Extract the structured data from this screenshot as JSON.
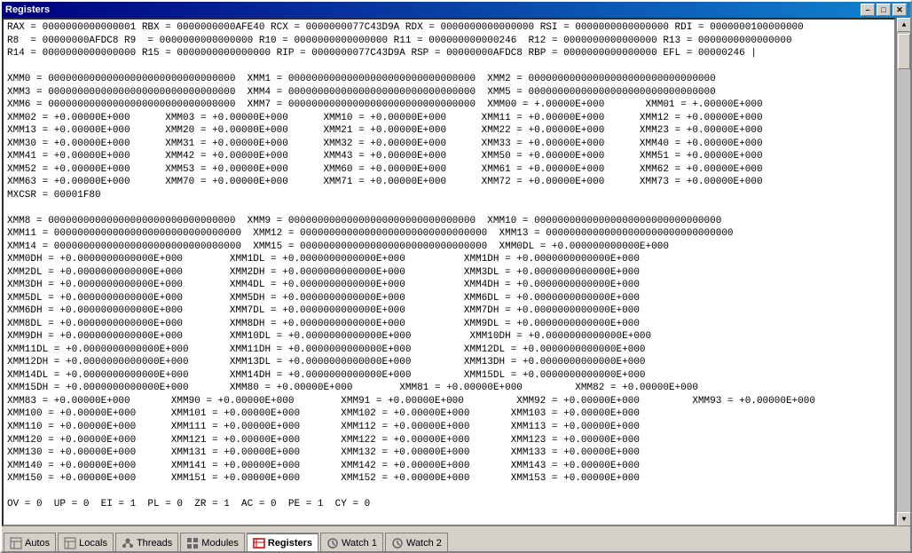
{
  "window": {
    "title": "Registers"
  },
  "title_buttons": {
    "minimize": "0",
    "maximize": "1",
    "close": "×"
  },
  "content": {
    "lines": [
      "RAX = 0000000000000001 RBX = 0000000000AFE40 RCX = 0000000077C43D9A RDX = 0000000000000000 RSI = 0000000000000000 RDI = 0000000100000000",
      "R8  = 00000000AFDC8 R9  = 0000000000000000 R10 = 0000000000000000 R11 = 000000000000246  R12 = 0000000000000000 R13 = 0000000000000000",
      "R14 = 0000000000000000 R15 = 0000000000000000 RIP = 0000000077C43D9A RSP = 00000000AFDC8 RBP = 0000000000000000 EFL = 00000246 |",
      "",
      "XMM0 = 00000000000000000000000000000000  XMM1 = 00000000000000000000000000000000  XMM2 = 00000000000000000000000000000000",
      "XMM3 = 00000000000000000000000000000000  XMM4 = 00000000000000000000000000000000  XMM5 = 00000000000000000000000000000000",
      "XMM6 = 00000000000000000000000000000000  XMM7 = 00000000000000000000000000000000  XMM00 = +.00000E+000       XMM01 = +.00000E+000",
      "XMM02 = +0.00000E+000      XMM03 = +0.00000E+000      XMM10 = +0.00000E+000      XMM11 = +0.00000E+000      XMM12 = +0.00000E+000",
      "XMM13 = +0.00000E+000      XMM20 = +0.00000E+000      XMM21 = +0.00000E+000      XMM22 = +0.00000E+000      XMM23 = +0.00000E+000",
      "XMM30 = +0.00000E+000      XMM31 = +0.00000E+000      XMM32 = +0.00000E+000      XMM33 = +0.00000E+000      XMM40 = +0.00000E+000",
      "XMM41 = +0.00000E+000      XMM42 = +0.00000E+000      XMM43 = +0.00000E+000      XMM50 = +0.00000E+000      XMM51 = +0.00000E+000",
      "XMM52 = +0.00000E+000      XMM53 = +0.00000E+000      XMM60 = +0.00000E+000      XMM61 = +0.00000E+000      XMM62 = +0.00000E+000",
      "XMM63 = +0.00000E+000      XMM70 = +0.00000E+000      XMM71 = +0.00000E+000      XMM72 = +0.00000E+000      XMM73 = +0.00000E+000",
      "MXCSR = 00001F80",
      "",
      "XMM8 = 00000000000000000000000000000000  XMM9 = 00000000000000000000000000000000  XMM10 = 00000000000000000000000000000000",
      "XMM11 = 00000000000000000000000000000000  XMM12 = 00000000000000000000000000000000  XMM13 = 00000000000000000000000000000000",
      "XMM14 = 00000000000000000000000000000000  XMM15 = 00000000000000000000000000000000  XMM0DL = +0.000000000000E+000",
      "XMM0DH = +0.0000000000000E+000        XMM1DL = +0.0000000000000E+000          XMM1DH = +0.0000000000000E+000",
      "XMM2DL = +0.0000000000000E+000        XMM2DH = +0.0000000000000E+000          XMM3DL = +0.0000000000000E+000",
      "XMM3DH = +0.0000000000000E+000        XMM4DL = +0.0000000000000E+000          XMM4DH = +0.0000000000000E+000",
      "XMM5DL = +0.0000000000000E+000        XMM5DH = +0.0000000000000E+000          XMM6DL = +0.0000000000000E+000",
      "XMM6DH = +0.0000000000000E+000        XMM7DL = +0.0000000000000E+000          XMM7DH = +0.0000000000000E+000",
      "XMM8DL = +0.0000000000000E+000        XMM8DH = +0.0000000000000E+000          XMM9DL = +0.0000000000000E+000",
      "XMM9DH = +0.0000000000000E+000        XMM10DL = +0.0000000000000E+000          XMM10DH = +0.0000000000000E+000",
      "XMM11DL = +0.0000000000000E+000       XMM11DH = +0.0000000000000E+000         XMM12DL = +0.0000000000000E+000",
      "XMM12DH = +0.0000000000000E+000       XMM13DL = +0.0000000000000E+000         XMM13DH = +0.0000000000000E+000",
      "XMM14DL = +0.0000000000000E+000       XMM14DH = +0.0000000000000E+000         XMM15DL = +0.0000000000000E+000",
      "XMM15DH = +0.0000000000000E+000       XMM80 = +0.00000E+000        XMM81 = +0.00000E+000         XMM82 = +0.00000E+000",
      "XMM83 = +0.00000E+000       XMM90 = +0.00000E+000        XMM91 = +0.00000E+000         XMM92 = +0.00000E+000         XMM93 = +0.00000E+000",
      "XMM100 = +0.00000E+000      XMM101 = +0.00000E+000       XMM102 = +0.00000E+000       XMM103 = +0.00000E+000",
      "XMM110 = +0.00000E+000      XMM111 = +0.00000E+000       XMM112 = +0.00000E+000       XMM113 = +0.00000E+000",
      "XMM120 = +0.00000E+000      XMM121 = +0.00000E+000       XMM122 = +0.00000E+000       XMM123 = +0.00000E+000",
      "XMM130 = +0.00000E+000      XMM131 = +0.00000E+000       XMM132 = +0.00000E+000       XMM133 = +0.00000E+000",
      "XMM140 = +0.00000E+000      XMM141 = +0.00000E+000       XMM142 = +0.00000E+000       XMM143 = +0.00000E+000",
      "XMM150 = +0.00000E+000      XMM151 = +0.00000E+000       XMM152 = +0.00000E+000       XMM153 = +0.00000E+000",
      "",
      "OV = 0  UP = 0  EI = 1  PL = 0  ZR = 1  AC = 0  PE = 1  CY = 0"
    ]
  },
  "tabs": [
    {
      "id": "autos",
      "label": "Autos",
      "icon": "table-icon",
      "active": false
    },
    {
      "id": "locals",
      "label": "Locals",
      "icon": "table-icon",
      "active": false
    },
    {
      "id": "threads",
      "label": "Threads",
      "icon": "threads-icon",
      "active": false
    },
    {
      "id": "modules",
      "label": "Modules",
      "icon": "modules-icon",
      "active": false
    },
    {
      "id": "registers",
      "label": "Registers",
      "icon": "registers-icon",
      "active": true
    },
    {
      "id": "watch1",
      "label": "Watch 1",
      "icon": "watch-icon",
      "active": false
    },
    {
      "id": "watch2",
      "label": "Watch 2",
      "icon": "watch-icon",
      "active": false
    }
  ]
}
